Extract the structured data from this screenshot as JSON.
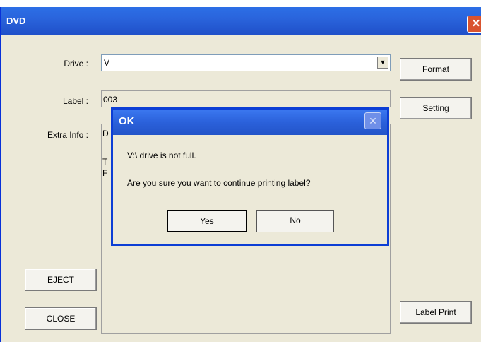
{
  "window": {
    "title": "DVD",
    "close_glyph": "✕"
  },
  "form": {
    "drive_label": "Drive :",
    "drive_value": "V",
    "label_label": "Label :",
    "label_value": "003",
    "extra_label": "Extra Info :",
    "extra_lines": [
      "D",
      "T",
      "F"
    ]
  },
  "buttons": {
    "format": "Format",
    "setting": "Setting",
    "eject": "EJECT",
    "close": "CLOSE",
    "label_print": "Label Print"
  },
  "dialog": {
    "title": "OK",
    "close_glyph": "✕",
    "line1": "V:\\ drive is not full.",
    "line2": "Are you sure you want to continue printing label?",
    "yes": "Yes",
    "no": "No"
  },
  "icons": {
    "dropdown": "chevron-down-icon"
  }
}
